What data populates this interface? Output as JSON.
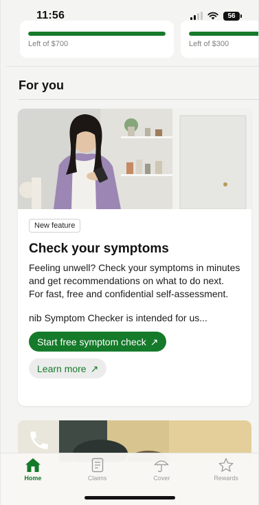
{
  "status_bar": {
    "time": "11:56",
    "battery": "56"
  },
  "allowances": [
    {
      "text": "Left of $700",
      "fill_fraction": 1.0
    },
    {
      "text": "Left of $300",
      "fill_fraction": 1.0
    }
  ],
  "section": {
    "title": "For you"
  },
  "feature_card": {
    "badge": "New feature",
    "title": "Check your symptoms",
    "description": "Feeling unwell? Check your symptoms in minutes and get recommendations on what to do next. For fast, free and confidential self-assessment.",
    "note": "nib Symptom Checker is intended for us...",
    "primary_button": "Start free symptom check",
    "secondary_button": "Learn more",
    "arrow_glyph": "↗"
  },
  "bottom_nav": {
    "items": [
      {
        "label": "Home",
        "icon": "home-icon",
        "active": true
      },
      {
        "label": "Claims",
        "icon": "document-icon",
        "active": false
      },
      {
        "label": "Cover",
        "icon": "umbrella-icon",
        "active": false
      },
      {
        "label": "Rewards",
        "icon": "star-icon",
        "active": false
      }
    ]
  },
  "colors": {
    "accent": "#157a2a",
    "background": "#f4f4f2",
    "card": "#ffffff",
    "muted_text": "#7d7d7d"
  }
}
